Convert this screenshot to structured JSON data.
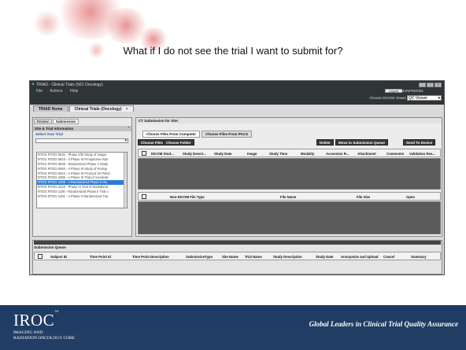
{
  "slide": {
    "title": "What if I do not see the trial I want to submit for?",
    "footer": {
      "logo_main": "IROC",
      "logo_tm": "™",
      "logo_sub1": "IMAGING AND",
      "logo_sub2": "RADIATION ONCOLOGY CORE",
      "tagline": "Global Leaders in Clinical Trial Quality Assurance",
      "colors": {
        "footer_bg": "#1d3b63"
      }
    }
  },
  "app": {
    "window_title": "TRIAD - Clinical Trials (NCI Oncology)",
    "menu": [
      "File",
      "Actions",
      "Help"
    ],
    "logout_label": "Logout",
    "username": "MANFREDI01",
    "viewer_label": "Choose DICOM Viewer",
    "viewer_value": "QC Viewer",
    "tabs": [
      {
        "label": "TRIAD Home"
      },
      {
        "label": "Clinical Trials (Oncology)",
        "close": "×"
      }
    ],
    "left_panel": {
      "subtabs": [
        "Review",
        "Submission"
      ],
      "section": "Site & Trial Information",
      "select_trial": "Select Your Trial",
      "trials": [
        "RTOG RTOG-0631 - Phase II/III Study of Image-",
        "RTOG RTOG-0815 - A Phase III Prospective Ran",
        "RTOG RTOG-0839 - Randomized Phase II Study",
        "RTOG RTOG-0920 - A Phase III Study of Postop",
        "RTOG RTOG-0924 - A Phase III Protocol for Pelvic",
        "RTOG RTOG-1005 - A Phase III Trial of Accelerat",
        "RTOG RTOG-1008 - A Randomized Phase II Stu",
        "RTOG RTOG-1016 - Phase III Trial of Radiothera",
        "RTOG RTOG-1106 - Randomized Phase II Trial o",
        "RTOG RTOG-1201 - A Phase II Randomized Tria"
      ],
      "selected_index": 6
    },
    "right_panel": {
      "header": "CT Submission for Site:",
      "file_tabs": [
        "Choose Files From Computer",
        "Choose Files From PACS"
      ],
      "buttons_left": [
        "Choose Files",
        "Choose Folder"
      ],
      "buttons_right": [
        "Delete",
        "Move to Submission Queue",
        "Send To Device"
      ],
      "dicom_columns": [
        "DICOM Stud...",
        "Study Descri...",
        "Study Date",
        "Image",
        "Study Time",
        "Modality",
        "Accession R...",
        "Attachment",
        "Comments",
        "Validation Res..."
      ],
      "nondicom_columns": [
        "Non-DICOM File Type",
        "File Name",
        "File Size",
        "Open"
      ]
    },
    "queue": {
      "title": "Submission Queue",
      "columns": [
        "Subject ID",
        "Time Point Id",
        "Time Point Description",
        "SubmissionType",
        "Site Name",
        "Trial Name",
        "Study Description",
        "Study Date",
        "Anonymize and Upload",
        "Cancel",
        "Summary"
      ]
    }
  }
}
